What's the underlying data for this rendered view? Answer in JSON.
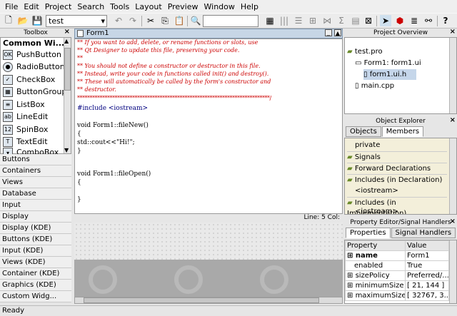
{
  "menus": [
    "File",
    "Edit",
    "Project",
    "Search",
    "Tools",
    "Layout",
    "Preview",
    "Window",
    "Help"
  ],
  "toolbar": {
    "project_combo": "test"
  },
  "toolbox": {
    "title": "Toolbox",
    "section": "Common Wi...",
    "items": [
      "PushButton",
      "RadioButton",
      "CheckBox",
      "ButtonGroup",
      "ListBox",
      "LineEdit",
      "SpinBox",
      "TextEdit",
      "ComboBox"
    ],
    "categories": [
      "Buttons",
      "Containers",
      "Views",
      "Database",
      "Input",
      "Display",
      "Display (KDE)",
      "Buttons (KDE)",
      "Input (KDE)",
      "Views (KDE)",
      "Container (KDE)",
      "Graphics (KDE)",
      "Custom Widg..."
    ]
  },
  "editor": {
    "title": "Form1",
    "comments": [
      "** If you want to add, delete, or rename functions or slots, use",
      "** Qt Designer to update this file, preserving your code.",
      "**",
      "** You should not define a constructor or destructor in this file.",
      "** Instead, write your code in functions called init() and destroy().",
      "** These will automatically be called by the form's constructor and",
      "** destructor.",
      "*****************************************************************************/"
    ],
    "lines": [
      "#include <iostream>",
      "",
      "void Form1::fileNew()",
      "{",
      "std::cout<<\"Hi!\";",
      "}",
      "",
      "",
      "void Form1::fileOpen()",
      "{",
      "",
      "}"
    ],
    "status": "Line: 5 Col:"
  },
  "project_overview": {
    "title": "Project Overview",
    "items": [
      "test.pro",
      "Form1: form1.ui",
      "form1.ui.h",
      "main.cpp"
    ]
  },
  "object_explorer": {
    "title": "Object Explorer",
    "tabs": [
      "Objects",
      "Members"
    ],
    "items": [
      "private",
      "Signals",
      "Forward Declarations",
      "Includes (in Declaration)",
      "<iostream>",
      "Includes (in Implementation)",
      "<iostream>"
    ]
  },
  "property_editor": {
    "title": "Property Editor/Signal Handlers",
    "tabs": [
      "Properties",
      "Signal Handlers"
    ],
    "headers": [
      "Property",
      "Value"
    ],
    "rows": [
      [
        "name",
        "Form1"
      ],
      [
        "enabled",
        "True"
      ],
      [
        "sizePolicy",
        "Preferred/..."
      ],
      [
        "minimumSize",
        "[ 21, 144 ]"
      ],
      [
        "maximumSize",
        "[ 32767, 3..."
      ]
    ]
  },
  "statusbar": "Ready"
}
